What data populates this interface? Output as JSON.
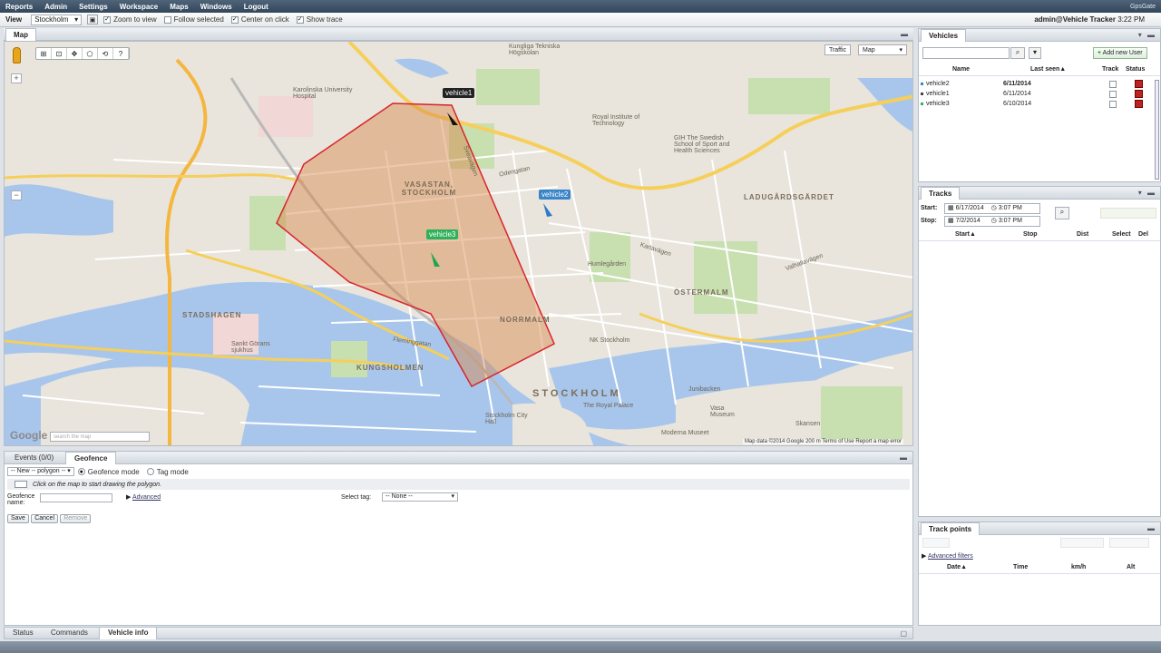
{
  "menu": {
    "items": [
      "Reports",
      "Admin",
      "Settings",
      "Workspace",
      "Maps",
      "Windows",
      "Logout"
    ],
    "brand": "GpsGate"
  },
  "toolbar": {
    "view_label": "View",
    "view_value": "Stockholm",
    "zoom_to_view": "Zoom to view",
    "follow_selected": "Follow selected",
    "center_on_click": "Center on click",
    "show_trace": "Show trace",
    "user": "admin@Vehicle Tracker",
    "time": "3:22 PM"
  },
  "map_panel": {
    "title": "Map",
    "traffic": "Traffic",
    "map_type": "Map",
    "search_placeholder": "search the map",
    "attribution": "Map data ©2014 Google   200 m     Terms of Use   Report a map error",
    "google": "Google",
    "labels": {
      "vasastan": "VASASTAN, STOCKHOLM",
      "ostermalm": "ÖSTERMALM",
      "norrmalm": "NORRMALM",
      "kungsholmen": "KUNGSHOLMEN",
      "stadshagen": "STADSHAGEN",
      "stockholm": "STOCKHOLM",
      "ladugardsgardet": "LADUGÅRDSGÄRDET",
      "karolinska": "Karolinska University Hospital",
      "kth": "Kungliga Tekniska Högskolan",
      "humlegarden": "Humlegården",
      "nk": "NK Stockholm",
      "royal_institute": "Royal Institute of Technology",
      "gih": "GIH The Swedish School of Sport and Health Sciences",
      "city_hall": "Stockholm City Hall",
      "royal_palace": "The Royal Palace",
      "moderna": "Moderna Museet",
      "skansen": "Skansen",
      "junibacken": "Junibacken",
      "vasa": "Vasa Museum",
      "hagastaden": "Sankt Görans sjukhus",
      "valhallavagen": "Valhallavägen",
      "karlavagen": "Karlavägen",
      "odengatan": "Odengatan",
      "sveavagen": "Sveavägen",
      "fleminggatan": "Fleminggatan"
    },
    "vehicles": [
      {
        "label": "vehicle1",
        "color": "#222222"
      },
      {
        "label": "vehicle2",
        "color": "#3a84c9"
      },
      {
        "label": "vehicle3",
        "color": "#2eb15a"
      }
    ]
  },
  "geofence": {
    "tabs": [
      "Events (0/0)",
      "Geofence"
    ],
    "new_select": "-- New -- polygon --",
    "mode_geofence": "Geofence mode",
    "mode_tag": "Tag mode",
    "hint": "Click on the map to start drawing the polygon.",
    "name_label": "Geofence name:",
    "advanced": "Advanced",
    "select_tag_label": "Select tag:",
    "select_tag_value": "-- None --",
    "save": "Save",
    "cancel": "Cancel",
    "remove": "Remove"
  },
  "bottom_tabs": [
    "Status",
    "Commands",
    "Vehicle info"
  ],
  "vehicles_panel": {
    "title": "Vehicles",
    "add_user": "Add new User",
    "columns": [
      "Name",
      "Last seen▲",
      "Track",
      "Status"
    ],
    "rows": [
      {
        "name": "vehicle2",
        "last_seen": "6/11/2014",
        "color": "#3a84c9"
      },
      {
        "name": "vehicle1",
        "last_seen": "6/11/2014",
        "color": "#444444"
      },
      {
        "name": "vehicle3",
        "last_seen": "6/10/2014",
        "color": "#2eb15a"
      }
    ]
  },
  "tracks_panel": {
    "title": "Tracks",
    "start_label": "Start:",
    "stop_label": "Stop:",
    "start_date": "6/17/2014",
    "start_time": "3:07 PM",
    "stop_date": "7/2/2014",
    "stop_time": "3:07 PM",
    "columns": [
      "Start▲",
      "Stop",
      "Dist",
      "Select",
      "Del"
    ]
  },
  "trackpoints_panel": {
    "title": "Track points",
    "advanced_filters": "Advanced filters",
    "columns": [
      "Date▲",
      "Time",
      "km/h",
      "Alt"
    ]
  }
}
